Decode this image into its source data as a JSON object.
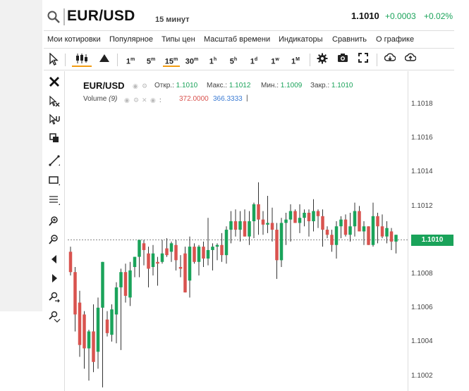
{
  "header": {
    "symbol": "EUR/USD",
    "timeframe": "15 минут",
    "price": "1.1010",
    "change_abs": "+0.0003",
    "change_pct": "+0.02%"
  },
  "menu": [
    "Мои котировки",
    "Популярное",
    "Типы цен",
    "Масштаб времени",
    "Индикаторы",
    "Сравнить",
    "О графике"
  ],
  "toolbar": {
    "intervals": [
      {
        "num": "1",
        "unit": "m"
      },
      {
        "num": "5",
        "unit": "m"
      },
      {
        "num": "15",
        "unit": "m"
      },
      {
        "num": "30",
        "unit": "m"
      },
      {
        "num": "1",
        "unit": "h"
      },
      {
        "num": "5",
        "unit": "h"
      },
      {
        "num": "1",
        "unit": "d"
      },
      {
        "num": "1",
        "unit": "w"
      },
      {
        "num": "1",
        "unit": "M"
      }
    ],
    "active_interval": "15m",
    "icons": [
      "cursor-icon",
      "candles-icon",
      "mountain-icon",
      "gear-icon",
      "camera-icon",
      "fullscreen-icon",
      "download-icon",
      "upload-icon"
    ]
  },
  "legend": {
    "symbol": "EUR/USD",
    "open_label": "Откр.:",
    "open": "1.1010",
    "high_label": "Макс.:",
    "high": "1.1012",
    "low_label": "Мин.:",
    "low": "1.1009",
    "close_label": "Закр.:",
    "close": "1.1010",
    "volume_name": "Volume",
    "volume_period": "(9)",
    "volume_a": "372.0000",
    "volume_b": "366.3333"
  },
  "price_axis": {
    "ticks": [
      "1.1018",
      "1.1016",
      "1.1014",
      "1.1012",
      "1.1010",
      "1.1008",
      "1.1006",
      "1.1004",
      "1.1002"
    ],
    "current": "1.1010"
  },
  "colors": {
    "up": "#1aa35a",
    "down": "#d9534f",
    "accent": "#f39c12"
  },
  "chart_data": {
    "type": "candlestick",
    "ylim": [
      1.1001,
      1.10195
    ],
    "current_price": 1.101,
    "candles": [
      {
        "o": 1.10093,
        "h": 1.10096,
        "l": 1.10079,
        "c": 1.10081
      },
      {
        "o": 1.10081,
        "h": 1.10084,
        "l": 1.10046,
        "c": 1.10056
      },
      {
        "o": 1.10063,
        "h": 1.1007,
        "l": 1.10031,
        "c": 1.10038
      },
      {
        "o": 1.10056,
        "h": 1.10058,
        "l": 1.10024,
        "c": 1.10036
      },
      {
        "o": 1.10036,
        "h": 1.10047,
        "l": 1.10017,
        "c": 1.10046
      },
      {
        "o": 1.10046,
        "h": 1.10062,
        "l": 1.10022,
        "c": 1.10028
      },
      {
        "o": 1.10034,
        "h": 1.10066,
        "l": 1.10024,
        "c": 1.1006
      },
      {
        "o": 1.1006,
        "h": 1.10087,
        "l": 1.10013,
        "c": 1.10087
      },
      {
        "o": 1.10053,
        "h": 1.10058,
        "l": 1.10043,
        "c": 1.10045
      },
      {
        "o": 1.10044,
        "h": 1.10062,
        "l": 1.1004,
        "c": 1.10059
      },
      {
        "o": 1.10056,
        "h": 1.10075,
        "l": 1.10039,
        "c": 1.10072
      },
      {
        "o": 1.10072,
        "h": 1.10083,
        "l": 1.10035,
        "c": 1.10081
      },
      {
        "o": 1.10081,
        "h": 1.10086,
        "l": 1.10063,
        "c": 1.10067
      },
      {
        "o": 1.10066,
        "h": 1.10087,
        "l": 1.10061,
        "c": 1.10082
      },
      {
        "o": 1.10084,
        "h": 1.1009,
        "l": 1.10078,
        "c": 1.1009
      },
      {
        "o": 1.1009,
        "h": 1.101,
        "l": 1.10078,
        "c": 1.101
      },
      {
        "o": 1.10098,
        "h": 1.101,
        "l": 1.10085,
        "c": 1.10094
      },
      {
        "o": 1.10092,
        "h": 1.10096,
        "l": 1.10072,
        "c": 1.10083
      },
      {
        "o": 1.10084,
        "h": 1.10097,
        "l": 1.10079,
        "c": 1.10092
      },
      {
        "o": 1.10087,
        "h": 1.1009,
        "l": 1.10073,
        "c": 1.10086
      },
      {
        "o": 1.10087,
        "h": 1.101,
        "l": 1.10086,
        "c": 1.10092
      },
      {
        "o": 1.10095,
        "h": 1.10101,
        "l": 1.1009,
        "c": 1.10091
      },
      {
        "o": 1.10093,
        "h": 1.10099,
        "l": 1.10087,
        "c": 1.10098
      },
      {
        "o": 1.10097,
        "h": 1.101,
        "l": 1.10082,
        "c": 1.10088
      },
      {
        "o": 1.10084,
        "h": 1.10091,
        "l": 1.10078,
        "c": 1.10083
      },
      {
        "o": 1.10092,
        "h": 1.10096,
        "l": 1.10069,
        "c": 1.10069
      },
      {
        "o": 1.10076,
        "h": 1.10102,
        "l": 1.10066,
        "c": 1.10096
      },
      {
        "o": 1.10096,
        "h": 1.10098,
        "l": 1.10086,
        "c": 1.10087
      },
      {
        "o": 1.10087,
        "h": 1.10097,
        "l": 1.10079,
        "c": 1.10096
      },
      {
        "o": 1.10096,
        "h": 1.10099,
        "l": 1.10084,
        "c": 1.10089
      },
      {
        "o": 1.10089,
        "h": 1.10113,
        "l": 1.10085,
        "c": 1.10094
      },
      {
        "o": 1.10094,
        "h": 1.10098,
        "l": 1.10082,
        "c": 1.10096
      },
      {
        "o": 1.10096,
        "h": 1.10098,
        "l": 1.10088,
        "c": 1.10097
      },
      {
        "o": 1.10097,
        "h": 1.10104,
        "l": 1.10087,
        "c": 1.10091
      },
      {
        "o": 1.10091,
        "h": 1.10108,
        "l": 1.10086,
        "c": 1.10106
      },
      {
        "o": 1.10106,
        "h": 1.10117,
        "l": 1.10098,
        "c": 1.10111
      },
      {
        "o": 1.10111,
        "h": 1.10118,
        "l": 1.10102,
        "c": 1.10106
      },
      {
        "o": 1.10106,
        "h": 1.10117,
        "l": 1.10099,
        "c": 1.10111
      },
      {
        "o": 1.10111,
        "h": 1.10118,
        "l": 1.10102,
        "c": 1.10102
      },
      {
        "o": 1.10102,
        "h": 1.10117,
        "l": 1.10097,
        "c": 1.10111
      },
      {
        "o": 1.10111,
        "h": 1.10122,
        "l": 1.10101,
        "c": 1.10121
      },
      {
        "o": 1.10121,
        "h": 1.10134,
        "l": 1.10103,
        "c": 1.10112
      },
      {
        "o": 1.10112,
        "h": 1.10117,
        "l": 1.10103,
        "c": 1.10109
      },
      {
        "o": 1.10109,
        "h": 1.10126,
        "l": 1.10104,
        "c": 1.1011
      },
      {
        "o": 1.1011,
        "h": 1.10119,
        "l": 1.10099,
        "c": 1.10106
      },
      {
        "o": 1.10106,
        "h": 1.1011,
        "l": 1.10077,
        "c": 1.10088
      },
      {
        "o": 1.10088,
        "h": 1.10113,
        "l": 1.10084,
        "c": 1.1011
      },
      {
        "o": 1.1011,
        "h": 1.10116,
        "l": 1.10097,
        "c": 1.10112
      },
      {
        "o": 1.10112,
        "h": 1.10121,
        "l": 1.10099,
        "c": 1.10117
      },
      {
        "o": 1.10117,
        "h": 1.10118,
        "l": 1.1011,
        "c": 1.1011
      },
      {
        "o": 1.1011,
        "h": 1.10121,
        "l": 1.10104,
        "c": 1.10113
      },
      {
        "o": 1.10113,
        "h": 1.10118,
        "l": 1.10108,
        "c": 1.10116
      },
      {
        "o": 1.10116,
        "h": 1.10118,
        "l": 1.10102,
        "c": 1.10111
      },
      {
        "o": 1.10111,
        "h": 1.10124,
        "l": 1.10105,
        "c": 1.10117
      },
      {
        "o": 1.10117,
        "h": 1.10118,
        "l": 1.10107,
        "c": 1.10114
      },
      {
        "o": 1.10114,
        "h": 1.10118,
        "l": 1.10096,
        "c": 1.10106
      },
      {
        "o": 1.10106,
        "h": 1.10108,
        "l": 1.10101,
        "c": 1.10103
      },
      {
        "o": 1.10103,
        "h": 1.10106,
        "l": 1.10093,
        "c": 1.10097
      },
      {
        "o": 1.10097,
        "h": 1.10111,
        "l": 1.10089,
        "c": 1.10108
      },
      {
        "o": 1.10108,
        "h": 1.10114,
        "l": 1.10101,
        "c": 1.10112
      },
      {
        "o": 1.10112,
        "h": 1.10115,
        "l": 1.10102,
        "c": 1.10103
      },
      {
        "o": 1.10103,
        "h": 1.10116,
        "l": 1.10099,
        "c": 1.10108
      },
      {
        "o": 1.10108,
        "h": 1.10122,
        "l": 1.10102,
        "c": 1.10117
      },
      {
        "o": 1.10117,
        "h": 1.1012,
        "l": 1.10105,
        "c": 1.10105
      },
      {
        "o": 1.10105,
        "h": 1.10111,
        "l": 1.10097,
        "c": 1.10108
      },
      {
        "o": 1.10108,
        "h": 1.10108,
        "l": 1.10097,
        "c": 1.10097
      },
      {
        "o": 1.10097,
        "h": 1.10122,
        "l": 1.10096,
        "c": 1.10114
      },
      {
        "o": 1.10114,
        "h": 1.10116,
        "l": 1.10098,
        "c": 1.10108
      },
      {
        "o": 1.10108,
        "h": 1.10115,
        "l": 1.10101,
        "c": 1.10102
      },
      {
        "o": 1.10102,
        "h": 1.10111,
        "l": 1.10098,
        "c": 1.10107
      },
      {
        "o": 1.10105,
        "h": 1.10107,
        "l": 1.10094,
        "c": 1.10099
      },
      {
        "o": 1.10099,
        "h": 1.10103,
        "l": 1.10092,
        "c": 1.10103
      }
    ]
  }
}
